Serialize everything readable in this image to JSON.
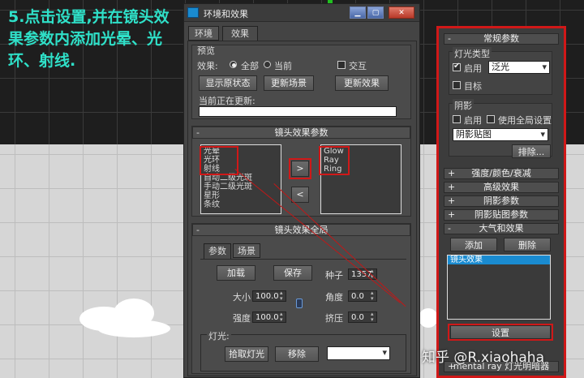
{
  "caption": "5.点击设置,并在镜头效果参数内添加光晕、光环、射线.",
  "dialog": {
    "title": "环境和效果",
    "win_min": "▁",
    "win_max": "▢",
    "win_close": "✕",
    "tabs": [
      "环境",
      "效果"
    ],
    "preview": {
      "header": "预览",
      "effects_label": "效果:",
      "radio_all": "全部",
      "radio_current": "当前",
      "interactive": "交互",
      "btn_show_original": "显示原状态",
      "btn_update_scene": "更新场景",
      "btn_update_effect": "更新效果",
      "currently_updating": "当前正在更新:",
      "currently_updating_value": ""
    },
    "lens_params": {
      "header": "镜头效果参数",
      "left_list": [
        "光晕",
        "光环",
        "射线",
        "自动二级光斑",
        "手动二级光斑",
        "星形",
        "条纹"
      ],
      "right_list": [
        "Glow",
        "Ray",
        "Ring"
      ],
      "btn_add": ">",
      "btn_remove": "<"
    },
    "lens_global": {
      "header": "镜头效果全局",
      "subtabs": [
        "参数",
        "场景"
      ],
      "btn_load": "加载",
      "btn_save": "保存",
      "seed_label": "种子",
      "seed_value": "1357",
      "size_label": "大小",
      "size_value": "100.0",
      "angle_label": "角度",
      "angle_value": "0.0",
      "intensity_label": "强度",
      "intensity_value": "100.0",
      "squeeze_label": "挤压",
      "squeeze_value": "0.0",
      "lights_label": "灯光:",
      "btn_pick_light": "拾取灯光",
      "btn_remove_light": "移除"
    }
  },
  "right_panel": {
    "general_header": "常规参数",
    "light_type_label": "灯光类型",
    "enable_label": "启用",
    "light_type_value": "泛光",
    "target_label": "目标",
    "shadow_label": "阴影",
    "shadow_enable": "启用",
    "use_global": "使用全局设置",
    "shadow_type_value": "阴影贴图",
    "exclude_btn": "排除...",
    "rollouts": [
      "强度/颜色/衰减",
      "高级效果",
      "阴影参数",
      "阴影贴图参数"
    ],
    "atmos_header": "大气和效果",
    "btn_add": "添加",
    "btn_delete": "删除",
    "effects_list": [
      "镜头效果"
    ],
    "btn_setup": "设置",
    "mentalray_header": "mental ray 灯光明暗器"
  },
  "watermark": "知乎 @R.xiaohaha",
  "colors": {
    "accent_red": "#d01818",
    "caption_cyan": "#2fe0c8",
    "selection_blue": "#1a8bd0"
  }
}
